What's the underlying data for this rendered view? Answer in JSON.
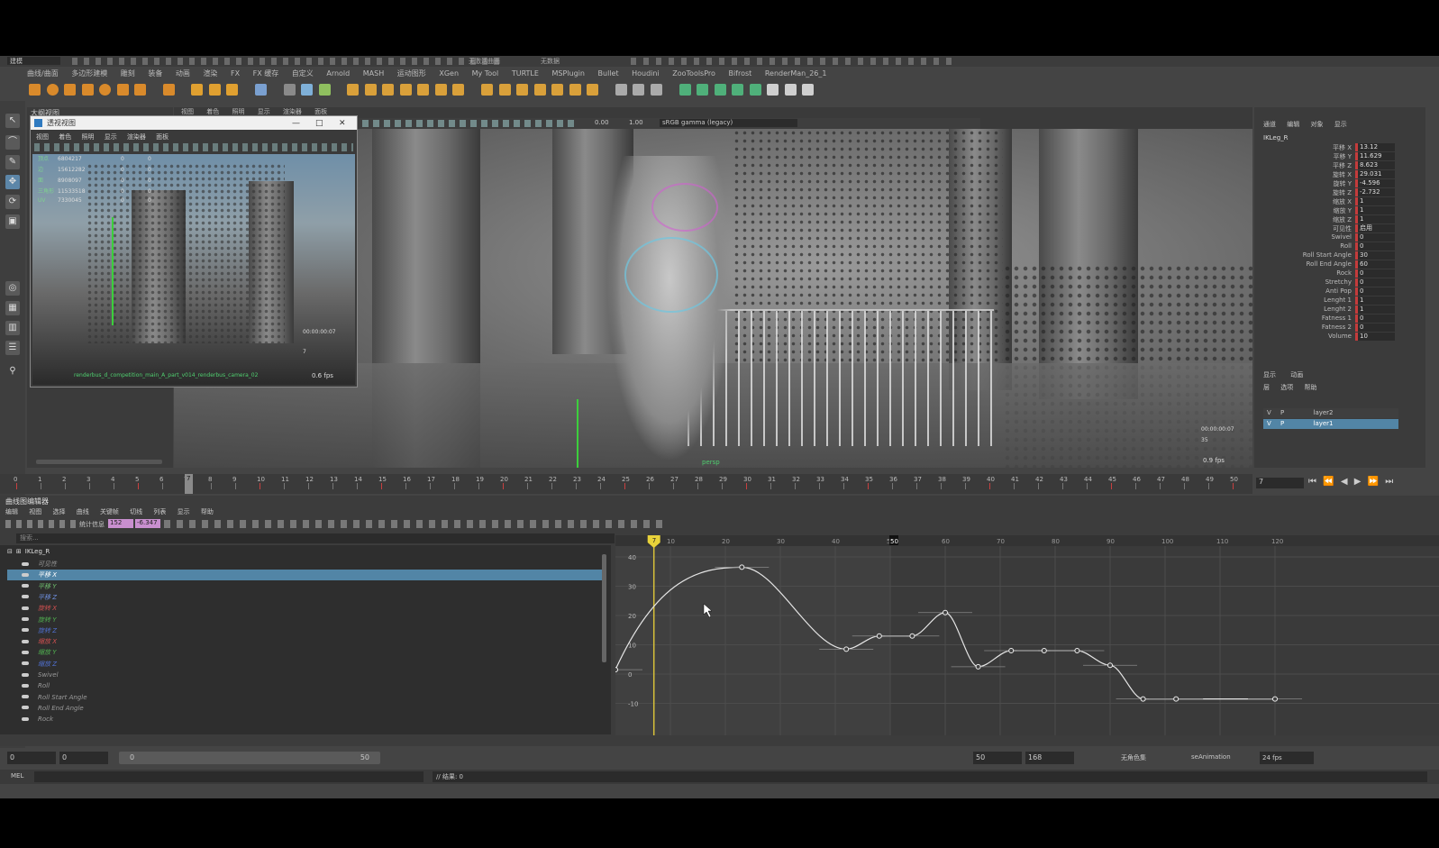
{
  "menu_bar": {
    "items": [
      "建模",
      "曲线/曲面",
      "多边形建模",
      "雕刻",
      "装备",
      "动画",
      "渲染",
      "FX",
      "FX 缓存",
      "自定义",
      "Arnold",
      "MASH",
      "运动图形",
      "XGen",
      "My Tool",
      "TURTLE",
      "MSPlugin",
      "Bullet",
      "Houdini",
      "ZooToolsPro",
      "Bifrost",
      "RenderMan_26_1"
    ]
  },
  "top_toolbar": {
    "workspace": "建模",
    "field_right": "无激活曲面",
    "field_far": "无数据"
  },
  "outliner": {
    "title": "大纲视图"
  },
  "float_window": {
    "title": "透视视图",
    "menu": [
      "视图",
      "着色",
      "照明",
      "显示",
      "渲染器",
      "面板"
    ],
    "stats": [
      {
        "label": "顶点",
        "a": "6804217",
        "b": "0",
        "c": "0"
      },
      {
        "label": "边",
        "a": "15612282",
        "b": "0",
        "c": "0"
      },
      {
        "label": "面",
        "a": "8908097",
        "b": "0",
        "c": "0"
      },
      {
        "label": "三角形",
        "a": "11533518",
        "b": "0",
        "c": "0"
      },
      {
        "label": "UV",
        "a": "7330045",
        "b": "0",
        "c": "0"
      }
    ],
    "camera_label": "renderbus_d_competition_main_A_part_v014_renderbus_camera_02",
    "fps": "0.6 fps",
    "timecode": "00:00:00:07",
    "frame": "7"
  },
  "viewport": {
    "menu": [
      "视图",
      "着色",
      "照明",
      "显示",
      "渲染器",
      "面板"
    ],
    "exposure": "0.00",
    "gamma": "1.00",
    "colorspace": "sRGB gamma (legacy)",
    "camera": "persp",
    "fps": "0.9 fps",
    "timecode": "00:00:00:07",
    "frame": "35"
  },
  "channel_box": {
    "menu": [
      "通道",
      "编辑",
      "对象",
      "显示"
    ],
    "object": "IKLeg_R",
    "attributes": [
      {
        "name": "平移 X",
        "value": "13.12",
        "keyed": true
      },
      {
        "name": "平移 Y",
        "value": "11.629",
        "keyed": true
      },
      {
        "name": "平移 Z",
        "value": "8.623",
        "keyed": true
      },
      {
        "name": "旋转 X",
        "value": "29.031",
        "keyed": true
      },
      {
        "name": "旋转 Y",
        "value": "-4.596",
        "keyed": true
      },
      {
        "name": "旋转 Z",
        "value": "-2.732",
        "keyed": true
      },
      {
        "name": "缩放 X",
        "value": "1",
        "keyed": true
      },
      {
        "name": "缩放 Y",
        "value": "1",
        "keyed": true
      },
      {
        "name": "缩放 Z",
        "value": "1",
        "keyed": true
      },
      {
        "name": "可见性",
        "value": "启用",
        "keyed": true
      },
      {
        "name": "Swivel",
        "value": "0",
        "keyed": true
      },
      {
        "name": "Roll",
        "value": "0",
        "keyed": true
      },
      {
        "name": "Roll Start Angle",
        "value": "30",
        "keyed": true
      },
      {
        "name": "Roll End Angle",
        "value": "60",
        "keyed": true
      },
      {
        "name": "Rock",
        "value": "0",
        "keyed": true
      },
      {
        "name": "Stretchy",
        "value": "0",
        "keyed": true
      },
      {
        "name": "Anti Pop",
        "value": "0",
        "keyed": true
      },
      {
        "name": "Lenght 1",
        "value": "1",
        "keyed": true
      },
      {
        "name": "Lenght 2",
        "value": "1",
        "keyed": true
      },
      {
        "name": "Fatness 1",
        "value": "0",
        "keyed": true
      },
      {
        "name": "Fatness 2",
        "value": "0",
        "keyed": true
      },
      {
        "name": "Volume",
        "value": "10",
        "keyed": true
      }
    ]
  },
  "layer_editor": {
    "tabs": [
      "显示",
      "动画"
    ],
    "menu": [
      "层",
      "选项",
      "帮助"
    ],
    "layers": [
      {
        "v": "V",
        "p": "P",
        "name": "layer2",
        "selected": false
      },
      {
        "v": "V",
        "p": "P",
        "name": "layer1",
        "selected": true
      }
    ]
  },
  "time_slider": {
    "ticks": [
      "0",
      "1",
      "2",
      "3",
      "4",
      "5",
      "6",
      "7",
      "8",
      "9",
      "10",
      "11",
      "12",
      "13",
      "14",
      "15",
      "16",
      "17",
      "18",
      "19",
      "20",
      "21",
      "22",
      "23",
      "24",
      "25",
      "26",
      "27",
      "28",
      "29",
      "30",
      "31",
      "32",
      "33",
      "34",
      "35",
      "36",
      "37",
      "38",
      "39",
      "40",
      "41",
      "42",
      "43",
      "44",
      "45",
      "46",
      "47",
      "48",
      "49",
      "50"
    ],
    "current_frame": "7"
  },
  "graph_editor": {
    "title": "曲线图编辑器",
    "menu": [
      "编辑",
      "视图",
      "选择",
      "曲线",
      "关键帧",
      "切线",
      "列表",
      "显示",
      "帮助"
    ],
    "stats_label": "统计信息",
    "frame_field": "152",
    "value_field": "-6.347",
    "search_placeholder": "搜索...",
    "node": "IKLeg_R",
    "channels": [
      {
        "name": "可见性",
        "color": "#9a9a9a",
        "selected": false
      },
      {
        "name": "平移 X",
        "color": "#e07070",
        "selected": true
      },
      {
        "name": "平移 Y",
        "color": "#6fbf6f",
        "selected": false
      },
      {
        "name": "平移 Z",
        "color": "#6f8fdf",
        "selected": false
      },
      {
        "name": "旋转 X",
        "color": "#d05050",
        "selected": false
      },
      {
        "name": "旋转 Y",
        "color": "#50b050",
        "selected": false
      },
      {
        "name": "旋转 Z",
        "color": "#5070d0",
        "selected": false
      },
      {
        "name": "缩放 X",
        "color": "#d05050",
        "selected": false
      },
      {
        "name": "缩放 Y",
        "color": "#50b050",
        "selected": false
      },
      {
        "name": "缩放 Z",
        "color": "#5070d0",
        "selected": false
      },
      {
        "name": "Swivel",
        "color": "#9a9a9a",
        "selected": false
      },
      {
        "name": "Roll",
        "color": "#9a9a9a",
        "selected": false
      },
      {
        "name": "Roll Start Angle",
        "color": "#9a9a9a",
        "selected": false
      },
      {
        "name": "Roll End Angle",
        "color": "#9a9a9a",
        "selected": false
      },
      {
        "name": "Rock",
        "color": "#9a9a9a",
        "selected": false
      }
    ],
    "x_ticks": [
      "10",
      "20",
      "30",
      "40",
      "50",
      "60",
      "70",
      "80",
      "90",
      "100",
      "110",
      "120"
    ],
    "x_marker": "50",
    "current_frame_marker": "7",
    "y_ticks": [
      "40",
      "30",
      "20",
      "10",
      "0",
      "-10"
    ],
    "curve_keys": [
      {
        "frame": 0,
        "value": 1.5
      },
      {
        "frame": 23,
        "value": 36.5
      },
      {
        "frame": 42,
        "value": 8.5
      },
      {
        "frame": 48,
        "value": 13
      },
      {
        "frame": 54,
        "value": 13
      },
      {
        "frame": 60,
        "value": 21
      },
      {
        "frame": 66,
        "value": 2.5
      },
      {
        "frame": 72,
        "value": 8
      },
      {
        "frame": 78,
        "value": 8
      },
      {
        "frame": 84,
        "value": 8
      },
      {
        "frame": 90,
        "value": 3
      },
      {
        "frame": 96,
        "value": -8.5
      },
      {
        "frame": 102,
        "value": -8.5
      },
      {
        "frame": 120,
        "value": -8.5
      }
    ]
  },
  "range_bar": {
    "start": "0",
    "anim_start": "0",
    "range_start": "0",
    "range_end": "50",
    "end": "50",
    "anim_end": "168",
    "character_set": "无角色集",
    "anim_layer": "seAnimation",
    "fps": "24 fps"
  },
  "command_line": {
    "mode": "MEL",
    "result": "// 结果: 0"
  }
}
